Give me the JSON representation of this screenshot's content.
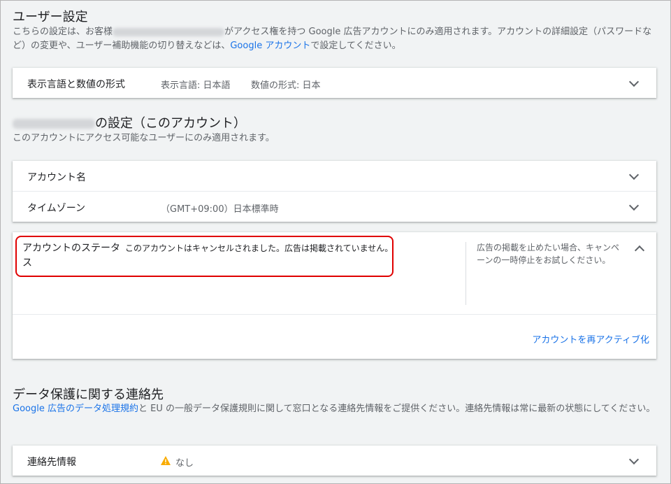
{
  "user_settings": {
    "title": "ユーザー設定",
    "desc_part1": "こちらの設定は、お客様",
    "desc_part2": "がアクセス権を持つ Google 広告アカウントにのみ適用されます。アカウントの詳細設定（パスワードなど）の変更や、ユーザー補助機能の切り替えなどは、",
    "desc_link": "Google アカウント",
    "desc_part3": "で設定してください。"
  },
  "language_row": {
    "label": "表示言語と数値の形式",
    "language": "表示言語: 日本語",
    "number_format": "数値の形式: 日本"
  },
  "account_settings": {
    "title_suffix": "の設定（このアカウント）",
    "desc": "このアカウントにアクセス可能なユーザーにのみ適用されます。",
    "rows": [
      {
        "label": "アカウント名",
        "value": ""
      },
      {
        "label": "タイムゾーン",
        "value": "（GMT+09:00）日本標準時"
      }
    ]
  },
  "status_card": {
    "label": "アカウントのステータス",
    "message": "このアカウントはキャンセルされました。広告は掲載されていません。",
    "hint": "広告の掲載を止めたい場合、キャンペーンの一時停止をお試しください。",
    "reactivate_link": "アカウントを再アクティブ化",
    "highlight_color": "#e00000"
  },
  "data_protection": {
    "title": "データ保護に関する連絡先",
    "link": "Google 広告のデータ処理規約",
    "desc": "と EU の一般データ保護規則に関して窓口となる連絡先情報をご提供ください。連絡先情報は常に最新の状態にしてください。"
  },
  "contact_row": {
    "label": "連絡先情報",
    "icon": "warning-icon",
    "value": "なし"
  },
  "colors": {
    "link": "#1a73e8",
    "warning": "#f9ab00"
  }
}
